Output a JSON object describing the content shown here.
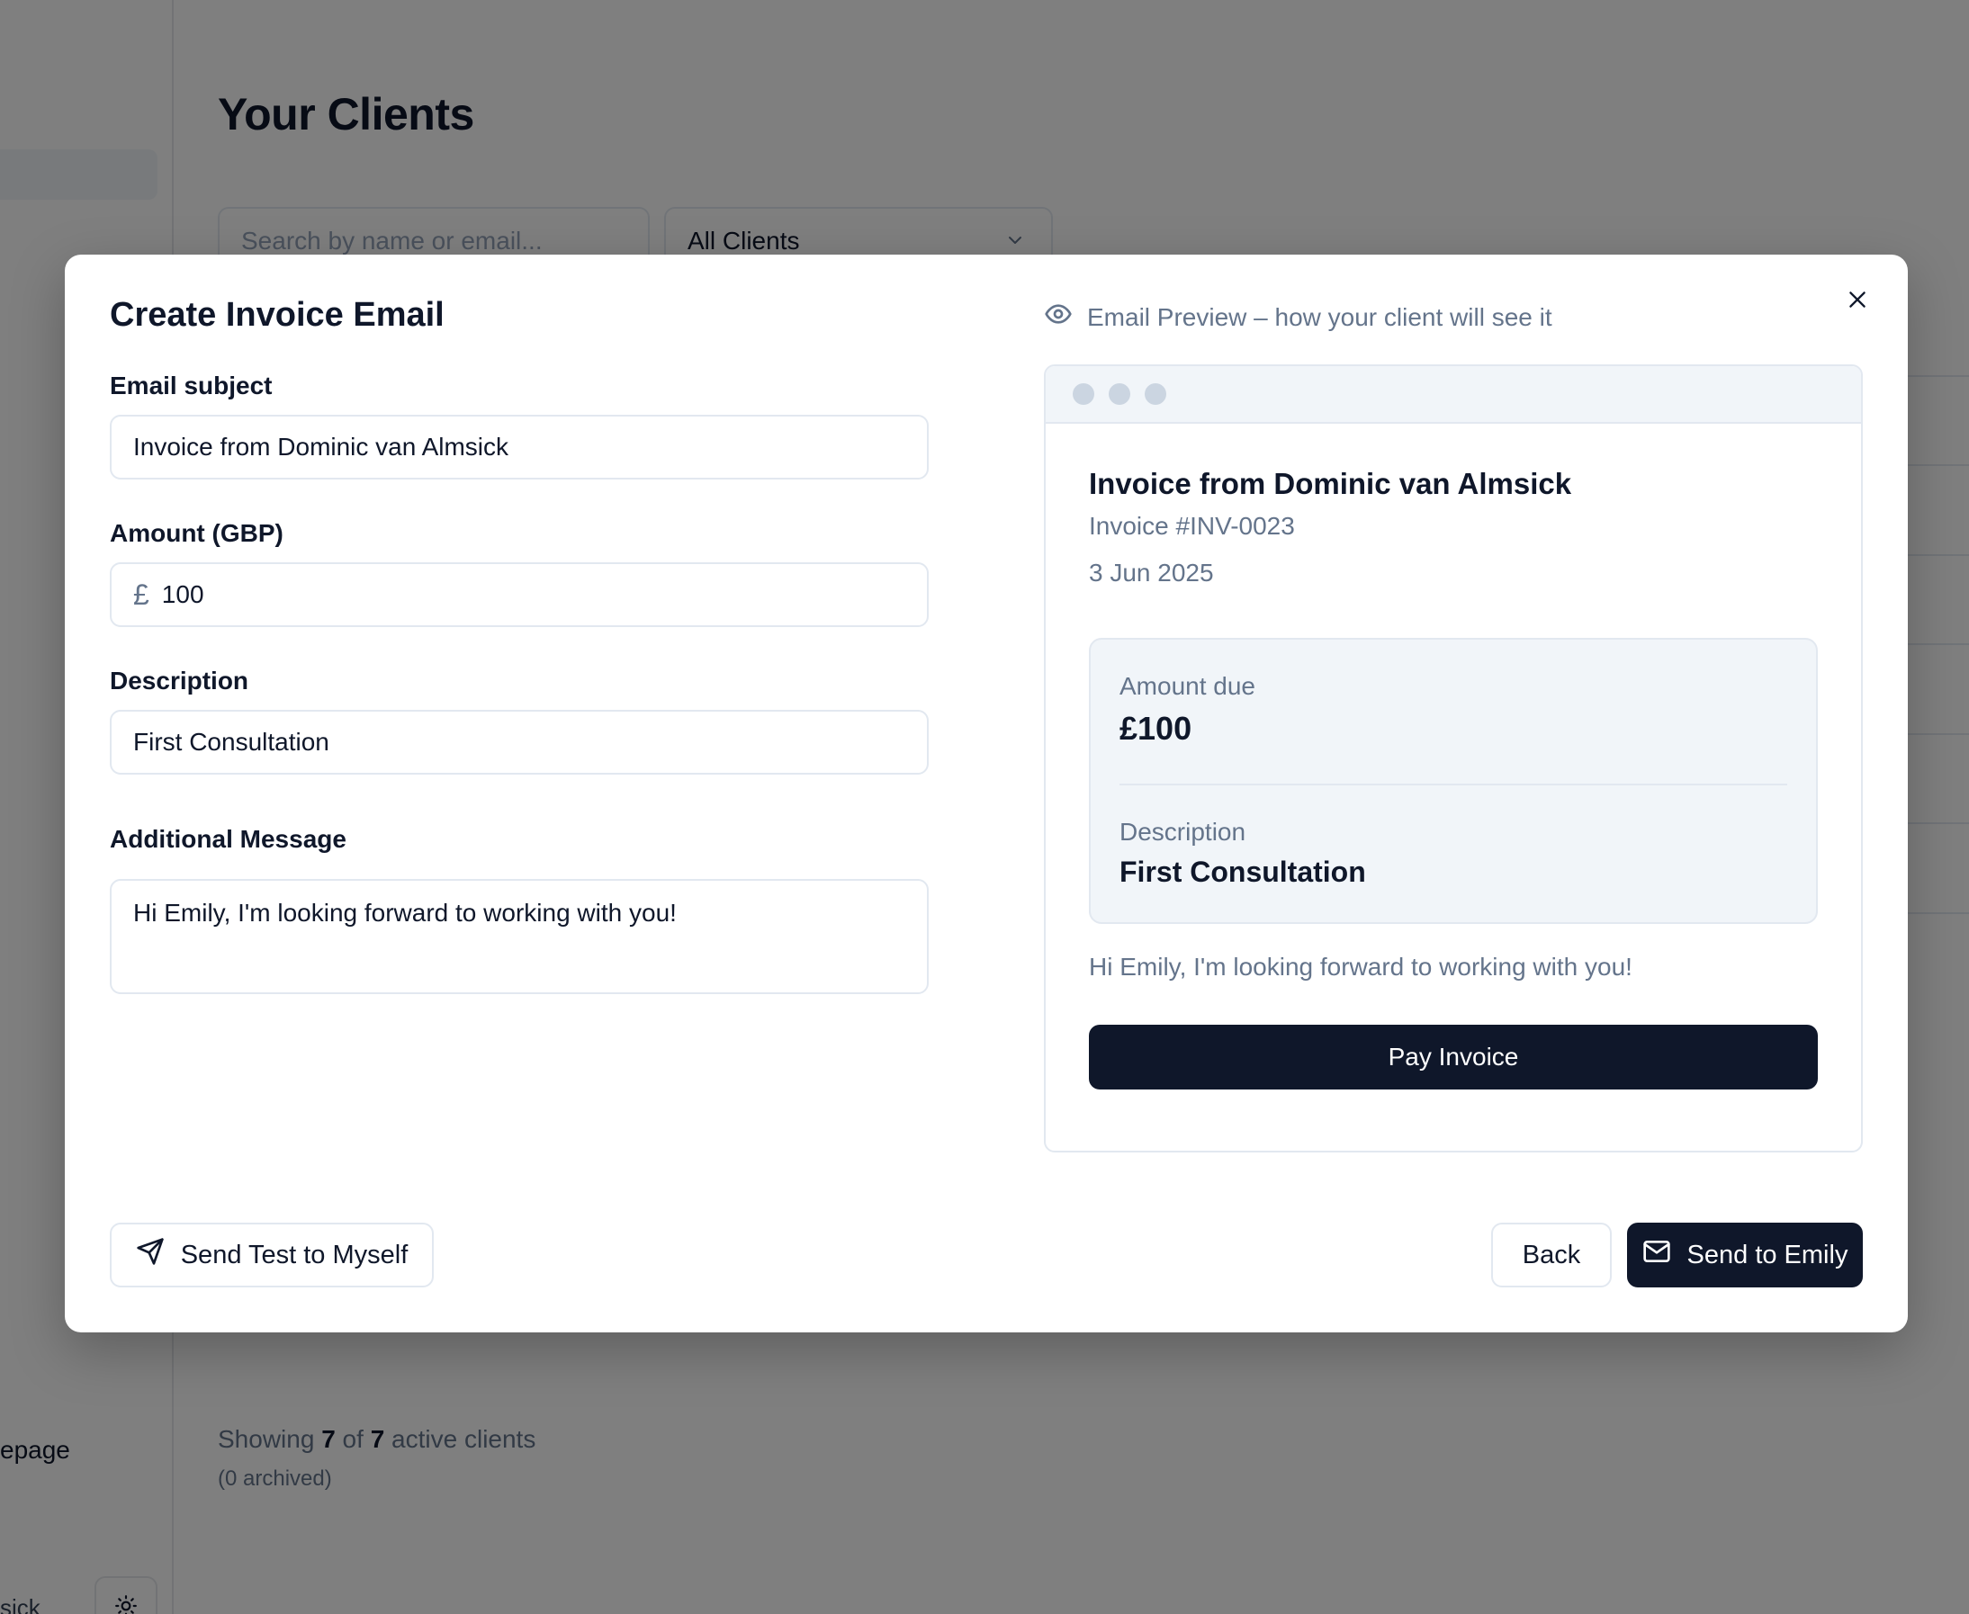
{
  "background": {
    "page_title": "Your Clients",
    "search_placeholder": "Search by name or email...",
    "filter_value": "All Clients",
    "sidebar_link_partial": "epage",
    "sidebar_user_partial": "sick",
    "footer": {
      "showing_prefix": "Showing ",
      "shown_count": "7",
      "of_word": " of ",
      "total_count": "7",
      "suffix": " active clients",
      "archived": "(0 archived)"
    }
  },
  "modal": {
    "title": "Create Invoice Email",
    "fields": {
      "subject_label": "Email subject",
      "subject_value": "Invoice from Dominic van Almsick",
      "amount_label": "Amount (GBP)",
      "currency_symbol": "£",
      "amount_value": "100",
      "description_label": "Description",
      "description_value": "First Consultation",
      "message_label": "Additional Message",
      "message_value": "Hi Emily, I'm looking forward to working with you!"
    },
    "preview": {
      "header": "Email Preview – how your client will see it",
      "title": "Invoice from Dominic van Almsick",
      "invoice_number": "Invoice #INV-0023",
      "date": "3 Jun 2025",
      "amount_due_label": "Amount due",
      "amount_due_value": "£100",
      "description_label": "Description",
      "description_value": "First Consultation",
      "message": "Hi Emily, I'm looking forward to working with you!",
      "pay_button": "Pay Invoice"
    },
    "buttons": {
      "send_test": "Send Test to Myself",
      "back": "Back",
      "send": "Send to Emily"
    }
  },
  "colors": {
    "primary": "#0f172a",
    "muted_text": "#64748b",
    "border": "#e2e8f0",
    "preview_card_bg": "#f1f5f9"
  },
  "icons": [
    "eye-icon",
    "close-icon",
    "send-icon",
    "mail-icon",
    "sun-icon",
    "chevron-down-icon"
  ]
}
